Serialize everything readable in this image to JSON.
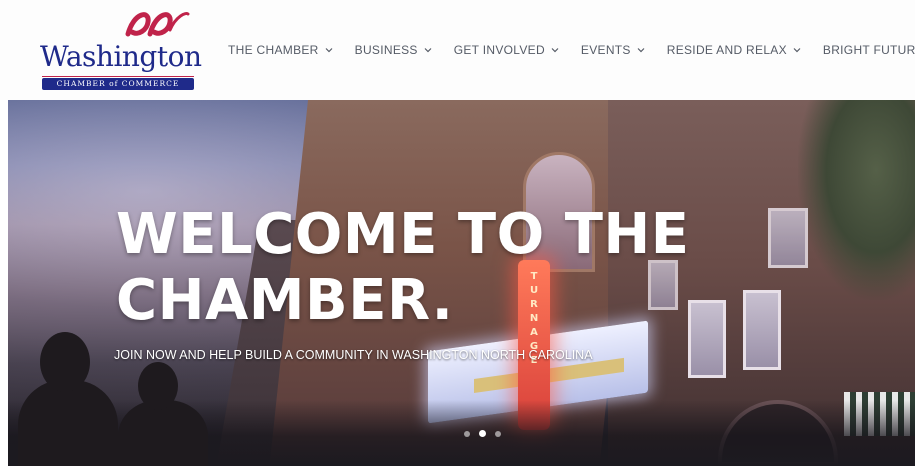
{
  "logo": {
    "wordmark": "Washington",
    "banner": "CHAMBER of COMMERCE",
    "colors": {
      "navy": "#1f2a8a",
      "red": "#c0234a"
    }
  },
  "nav": {
    "items": [
      {
        "label": "THE CHAMBER",
        "icon": "chevron-down-icon"
      },
      {
        "label": "BUSINESS",
        "icon": "chevron-down-icon"
      },
      {
        "label": "GET INVOLVED",
        "icon": "chevron-down-icon"
      },
      {
        "label": "EVENTS",
        "icon": "chevron-down-icon"
      },
      {
        "label": "RESIDE AND RELAX",
        "icon": "chevron-down-icon"
      },
      {
        "label": "BRIGHT FUTURES"
      }
    ],
    "text_color": "#555b66"
  },
  "hero": {
    "title_line1": "WELCOME TO THE",
    "title_line2": "CHAMBER.",
    "subtitle": "JOIN NOW AND HELP BUILD A COMMUNITY  IN WASHINGTON NORTH CAROLINA",
    "sign_letters": "TURNAGE",
    "slider": {
      "count": 3,
      "active_index": 1
    }
  }
}
